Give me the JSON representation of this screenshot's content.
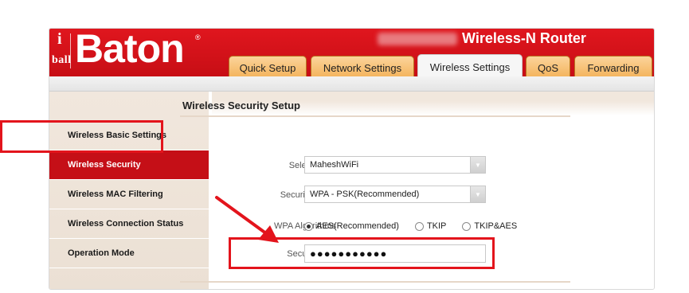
{
  "brand": {
    "logo_i": "i",
    "logo_ball": "ball",
    "logo_name": "Baton",
    "logo_mark": "®"
  },
  "product_title": "Wireless-N Router",
  "tabs": [
    {
      "label": "Quick Setup"
    },
    {
      "label": "Network Settings"
    },
    {
      "label": "Wireless Settings"
    },
    {
      "label": "QoS"
    },
    {
      "label": "Forwarding"
    }
  ],
  "sidebar": {
    "items": [
      {
        "label": "Wireless Basic Settings"
      },
      {
        "label": "Wireless Security"
      },
      {
        "label": "Wireless MAC Filtering"
      },
      {
        "label": "Wireless Connection Status"
      },
      {
        "label": "Operation Mode"
      }
    ]
  },
  "section": {
    "title": "Wireless Security Setup"
  },
  "form": {
    "ssid": {
      "label": "Select SSID",
      "value": "MaheshWiFi"
    },
    "mode": {
      "label": "Security Mode",
      "value": "WPA - PSK(Recommended)"
    },
    "algorithms": {
      "label": "WPA Algorithms",
      "options": [
        {
          "label": "AES(Recommended)",
          "checked": true
        },
        {
          "label": "TKIP",
          "checked": false
        },
        {
          "label": "TKIP&AES",
          "checked": false
        }
      ]
    },
    "key": {
      "label": "Security Key",
      "value": "●●●●●●●●●●●"
    }
  },
  "colors": {
    "brand_red": "#c70e15",
    "tab_orange": "#f3b055",
    "highlight_red": "#e3141c"
  }
}
